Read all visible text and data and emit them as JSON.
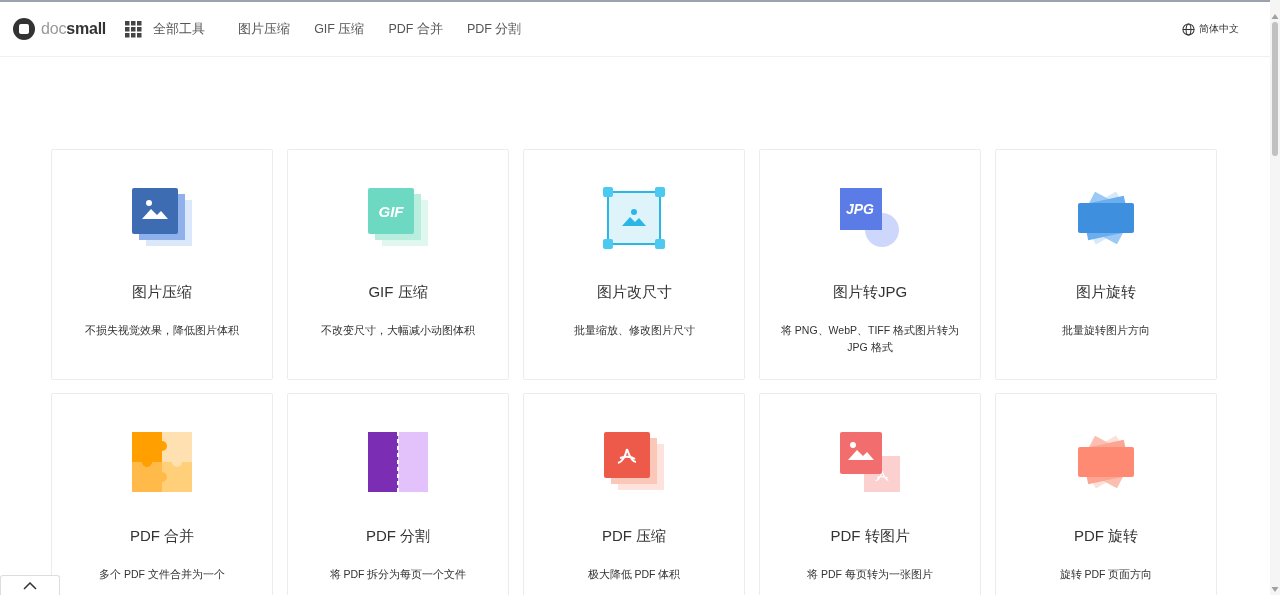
{
  "header": {
    "logo": "doc**small**",
    "all_tools": "全部工具",
    "nav": [
      "图片压缩",
      "GIF 压缩",
      "PDF 合并",
      "PDF 分割"
    ],
    "language": "简体中文"
  },
  "tools": [
    {
      "kind": "image-stack",
      "title": "图片压缩",
      "description": "不损失视觉效果，降低图片体积"
    },
    {
      "kind": "gif",
      "icon_text": "GIF",
      "title": "GIF 压缩",
      "description": "不改变尺寸，大幅减小动图体积"
    },
    {
      "kind": "resize",
      "title": "图片改尺寸",
      "description": "批量缩放、修改图片尺寸"
    },
    {
      "kind": "jpg",
      "icon_text": "JPG",
      "title": "图片转JPG",
      "description": "将 PNG、WebP、TIFF 格式图片转为 JPG 格式"
    },
    {
      "kind": "rotate",
      "title": "图片旋转",
      "description": "批量旋转图片方向"
    },
    {
      "kind": "puzzle",
      "title": "PDF 合并",
      "description": "多个 PDF 文件合并为一个"
    },
    {
      "kind": "split",
      "title": "PDF 分割",
      "description": "将 PDF 拆分为每页一个文件"
    },
    {
      "kind": "pdf-stack",
      "title": "PDF 压缩",
      "description": "极大降低 PDF 体积"
    },
    {
      "kind": "pdf-image",
      "title": "PDF 转图片",
      "description": "将 PDF 每页转为一张图片"
    },
    {
      "kind": "pdf-rotate",
      "title": "PDF 旋转",
      "description": "旋转 PDF 页面方向"
    }
  ]
}
